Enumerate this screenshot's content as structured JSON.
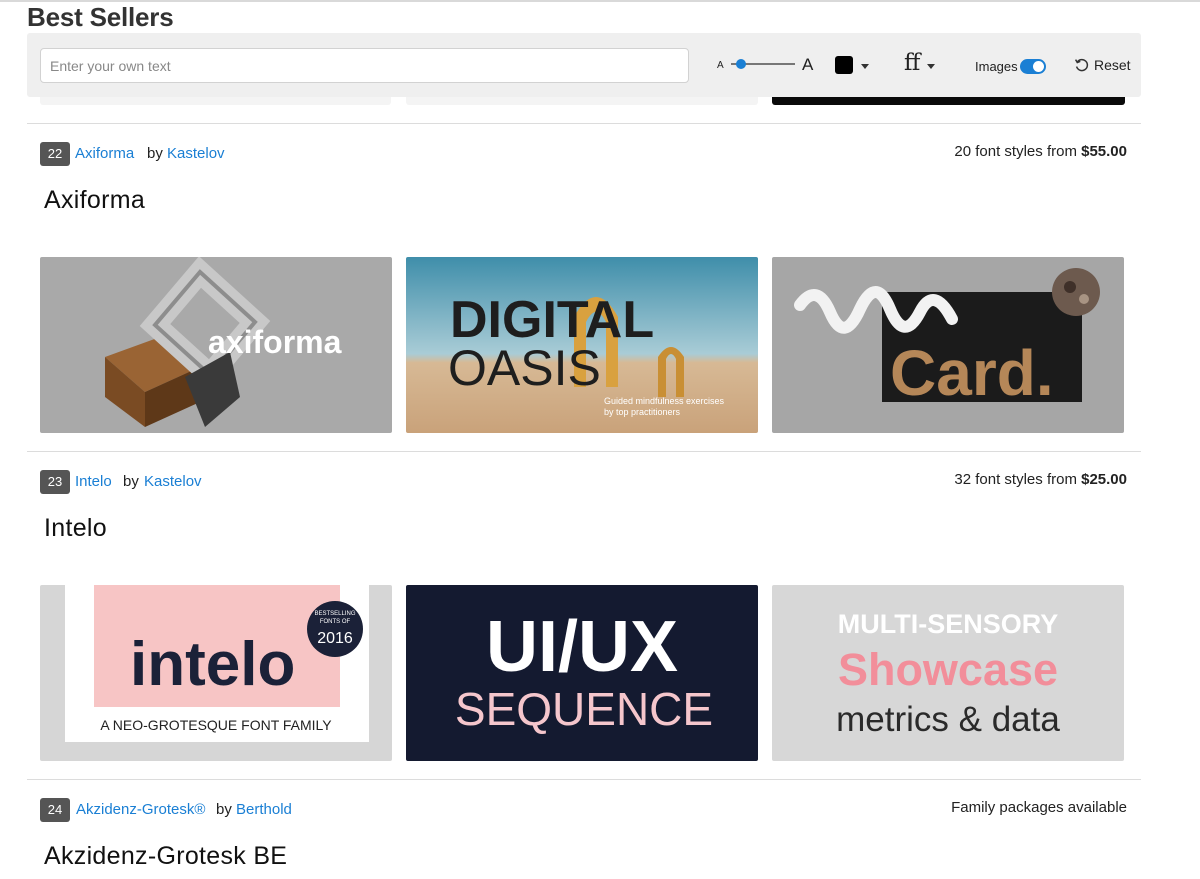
{
  "page": {
    "title": "Best Sellers"
  },
  "toolbar": {
    "input_placeholder": "Enter your own text",
    "size_small_label": "A",
    "size_large_label": "A",
    "color_value": "#000000",
    "ff_label": "ff",
    "images_label": "Images",
    "images_enabled": true,
    "reset_label": "Reset",
    "accent_color": "#1a7fd4"
  },
  "fonts": [
    {
      "rank": "22",
      "name": "Axiforma",
      "by": "by",
      "designer": "Kastelov",
      "price_prefix": "20 font styles from ",
      "price_value": "$55.00",
      "specimen": "Axiforma",
      "cards": [
        {
          "text": "axiforma"
        },
        {
          "line1": "DIGITAL",
          "line2": "OASIS",
          "caption1": "Guided mindfulness exercises",
          "caption2": "by top practitioners"
        },
        {
          "text": "Card."
        }
      ]
    },
    {
      "rank": "23",
      "name": "Intelo",
      "by": "by",
      "designer": "Kastelov",
      "price_prefix": "32 font styles from ",
      "price_value": "$25.00",
      "specimen": "Intelo",
      "cards": [
        {
          "word": "intelo",
          "badge1": "BESTSELLING",
          "badge2": "FONTS OF",
          "badge_year": "2016",
          "tagline": "A NEO-GROTESQUE FONT FAMILY"
        },
        {
          "line1": "UI/UX",
          "line2": "SEQUENCE"
        },
        {
          "line1": "MULTI-SENSORY",
          "line2": "Showcase",
          "line3": "metrics & data"
        }
      ]
    },
    {
      "rank": "24",
      "name": "Akzidenz-Grotesk®",
      "by": "by",
      "designer": "Berthold",
      "price_prefix": "Family packages available",
      "price_value": "",
      "specimen": "Akzidenz-Grotesk BE"
    }
  ]
}
